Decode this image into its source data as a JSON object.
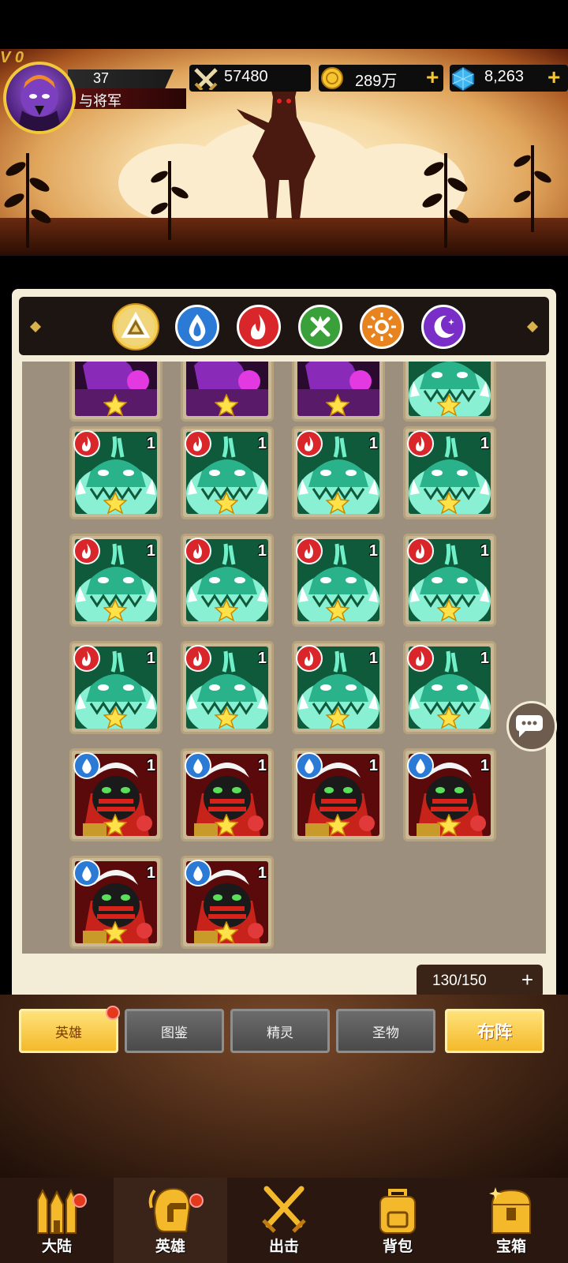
{
  "player": {
    "vip_label": "V 0",
    "level": "37",
    "name": "与将军"
  },
  "resources": {
    "power": "57480",
    "gold": "289万",
    "gems": "8,263",
    "plus": "+"
  },
  "element_filter": {
    "icons": [
      "all-elements-icon",
      "water-icon",
      "fire-icon",
      "wind-icon",
      "sun-icon",
      "moon-icon"
    ],
    "selected": "all-elements-icon"
  },
  "hero_grid": {
    "count_label": "1",
    "capacity": "130/150",
    "capacity_plus": "+"
  },
  "sub_tabs": {
    "heroes": "英雄",
    "codex": "图鉴",
    "spirits": "精灵",
    "relics": "圣物",
    "formation": "布阵"
  },
  "bottom_nav": {
    "continent": "大陆",
    "heroes": "英雄",
    "battle": "出击",
    "bag": "背包",
    "chest": "宝箱"
  },
  "colors": {
    "accent_gold": "#f5c730",
    "fire_badge": "#d8262a",
    "water_badge": "#2a7ad6"
  }
}
